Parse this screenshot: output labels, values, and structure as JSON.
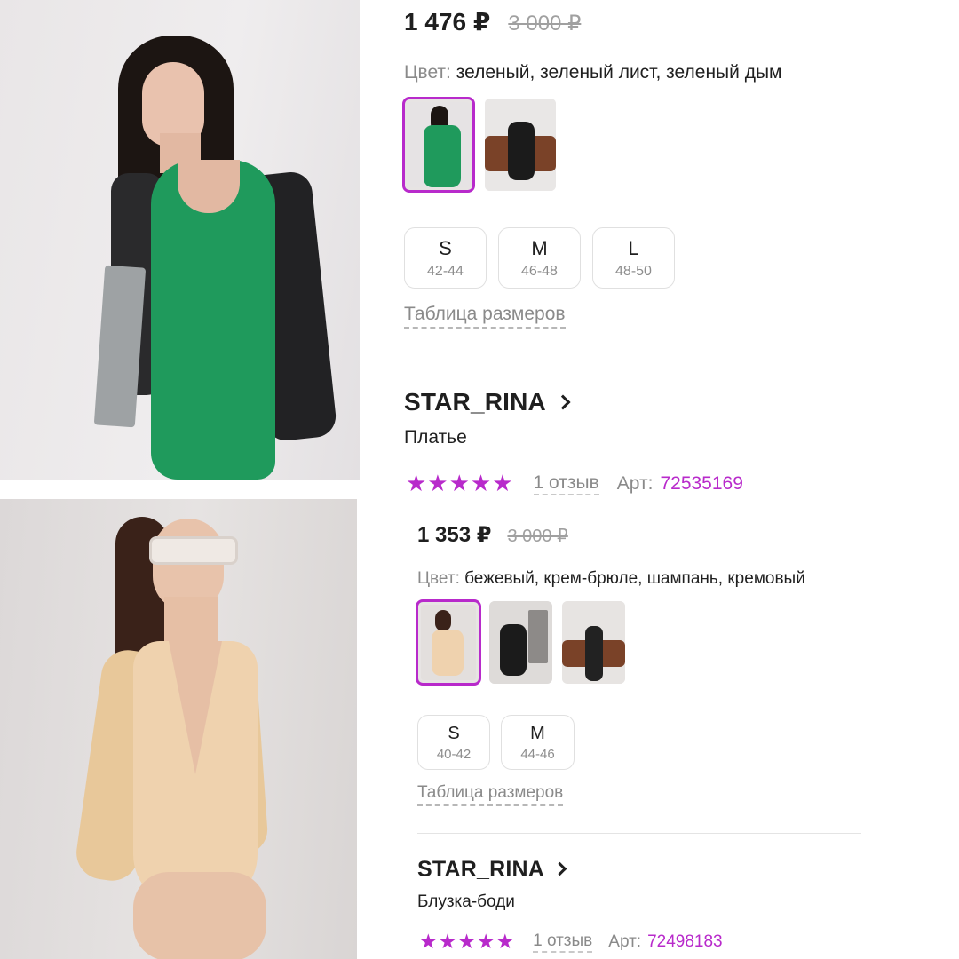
{
  "products": [
    {
      "price": "1 476 ₽",
      "old_price": "3 000 ₽",
      "color_label": "Цвет:",
      "color_value": "зеленый, зеленый лист, зеленый дым",
      "sizes": [
        {
          "size": "S",
          "range": "42-44"
        },
        {
          "size": "M",
          "range": "46-48"
        },
        {
          "size": "L",
          "range": "48-50"
        }
      ],
      "size_table_label": "Таблица размеров",
      "brand": "STAR_RINA",
      "product_type": "Платье",
      "stars": "★★★★★",
      "reviews": "1 отзыв",
      "article_label": "Арт:",
      "article": "72535169"
    },
    {
      "price": "1 353 ₽",
      "old_price": "3 000 ₽",
      "color_label": "Цвет:",
      "color_value": "бежевый, крем-брюле, шампань, кремовый",
      "sizes": [
        {
          "size": "S",
          "range": "40-42"
        },
        {
          "size": "M",
          "range": "44-46"
        }
      ],
      "size_table_label": "Таблица размеров",
      "brand": "STAR_RINA",
      "product_type": "Блузка-боди",
      "stars": "★★★★★",
      "reviews": "1 отзыв",
      "article_label": "Арт:",
      "article": "72498183"
    }
  ],
  "colors": {
    "accent": "#b82acb",
    "dress_green": "#1f9a5c",
    "bodysuit_beige": "#efd2ae"
  }
}
